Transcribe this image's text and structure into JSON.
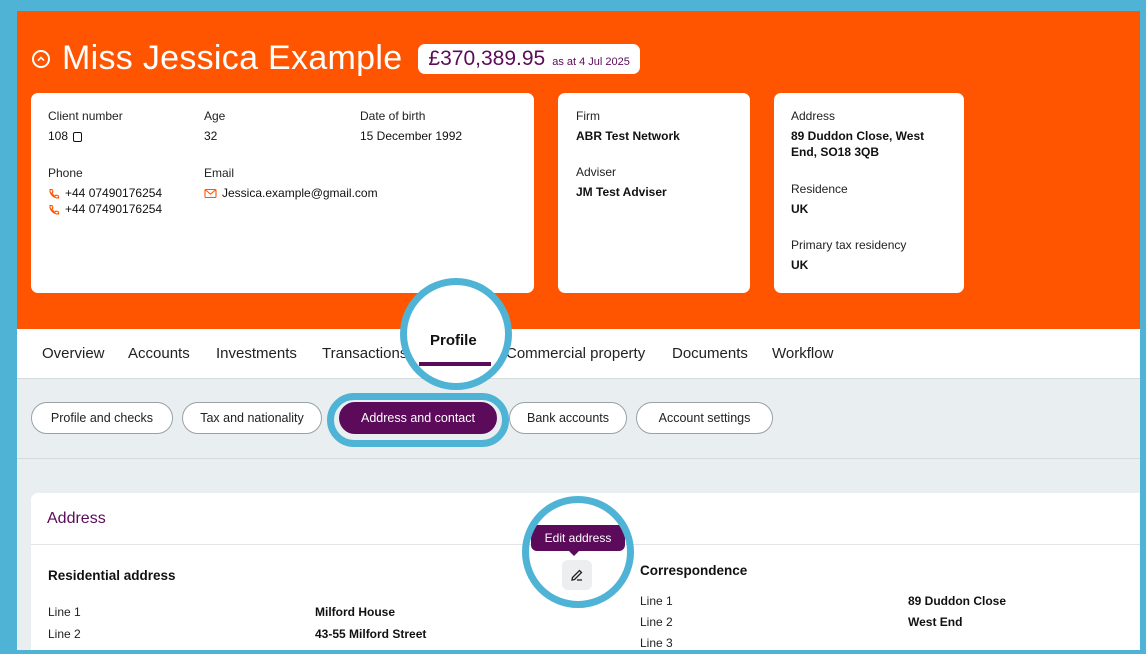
{
  "header": {
    "client_name": "Miss Jessica Example",
    "portfolio_value": "£370,389.95",
    "value_date": "as at 4 Jul 2025"
  },
  "details": {
    "client_number_label": "Client number",
    "client_number": "108",
    "age_label": "Age",
    "age": "32",
    "dob_label": "Date of birth",
    "dob": "15 December 1992",
    "phone_label": "Phone",
    "phones": [
      "+44 07490176254",
      "+44 07490176254"
    ],
    "email_label": "Email",
    "email": "Jessica.example@gmail.com",
    "firm_label": "Firm",
    "firm": "ABR Test Network",
    "adviser_label": "Adviser",
    "adviser": "JM Test Adviser",
    "address_label": "Address",
    "address": "89 Duddon Close, West End, SO18 3QB",
    "residence_label": "Residence",
    "residence": "UK",
    "tax_label": "Primary tax residency",
    "tax": "UK"
  },
  "tabs": [
    {
      "label": "Overview"
    },
    {
      "label": "Accounts"
    },
    {
      "label": "Investments"
    },
    {
      "label": "Transactions"
    },
    {
      "label": "Profile"
    },
    {
      "label": "Commercial property"
    },
    {
      "label": "Documents"
    },
    {
      "label": "Workflow"
    }
  ],
  "subtabs": [
    {
      "label": "Profile and checks"
    },
    {
      "label": "Tax and nationality"
    },
    {
      "label": "Address and contact"
    },
    {
      "label": "Bank accounts"
    },
    {
      "label": "Account settings"
    }
  ],
  "address_panel": {
    "title": "Address",
    "edit_tooltip": "Edit address",
    "residential": {
      "title": "Residential address",
      "rows": [
        {
          "label": "Line 1",
          "value": "Milford House"
        },
        {
          "label": "Line 2",
          "value": "43-55 Milford Street"
        }
      ]
    },
    "correspondence": {
      "title": "Correspondence",
      "rows": [
        {
          "label": "Line 1",
          "value": "89 Duddon Close"
        },
        {
          "label": "Line 2",
          "value": "West End"
        },
        {
          "label": "Line 3",
          "value": ""
        }
      ]
    }
  },
  "colors": {
    "brand_orange": "#ff5400",
    "brand_purple": "#5b0b5a",
    "highlight_blue": "#4fb3d5"
  }
}
